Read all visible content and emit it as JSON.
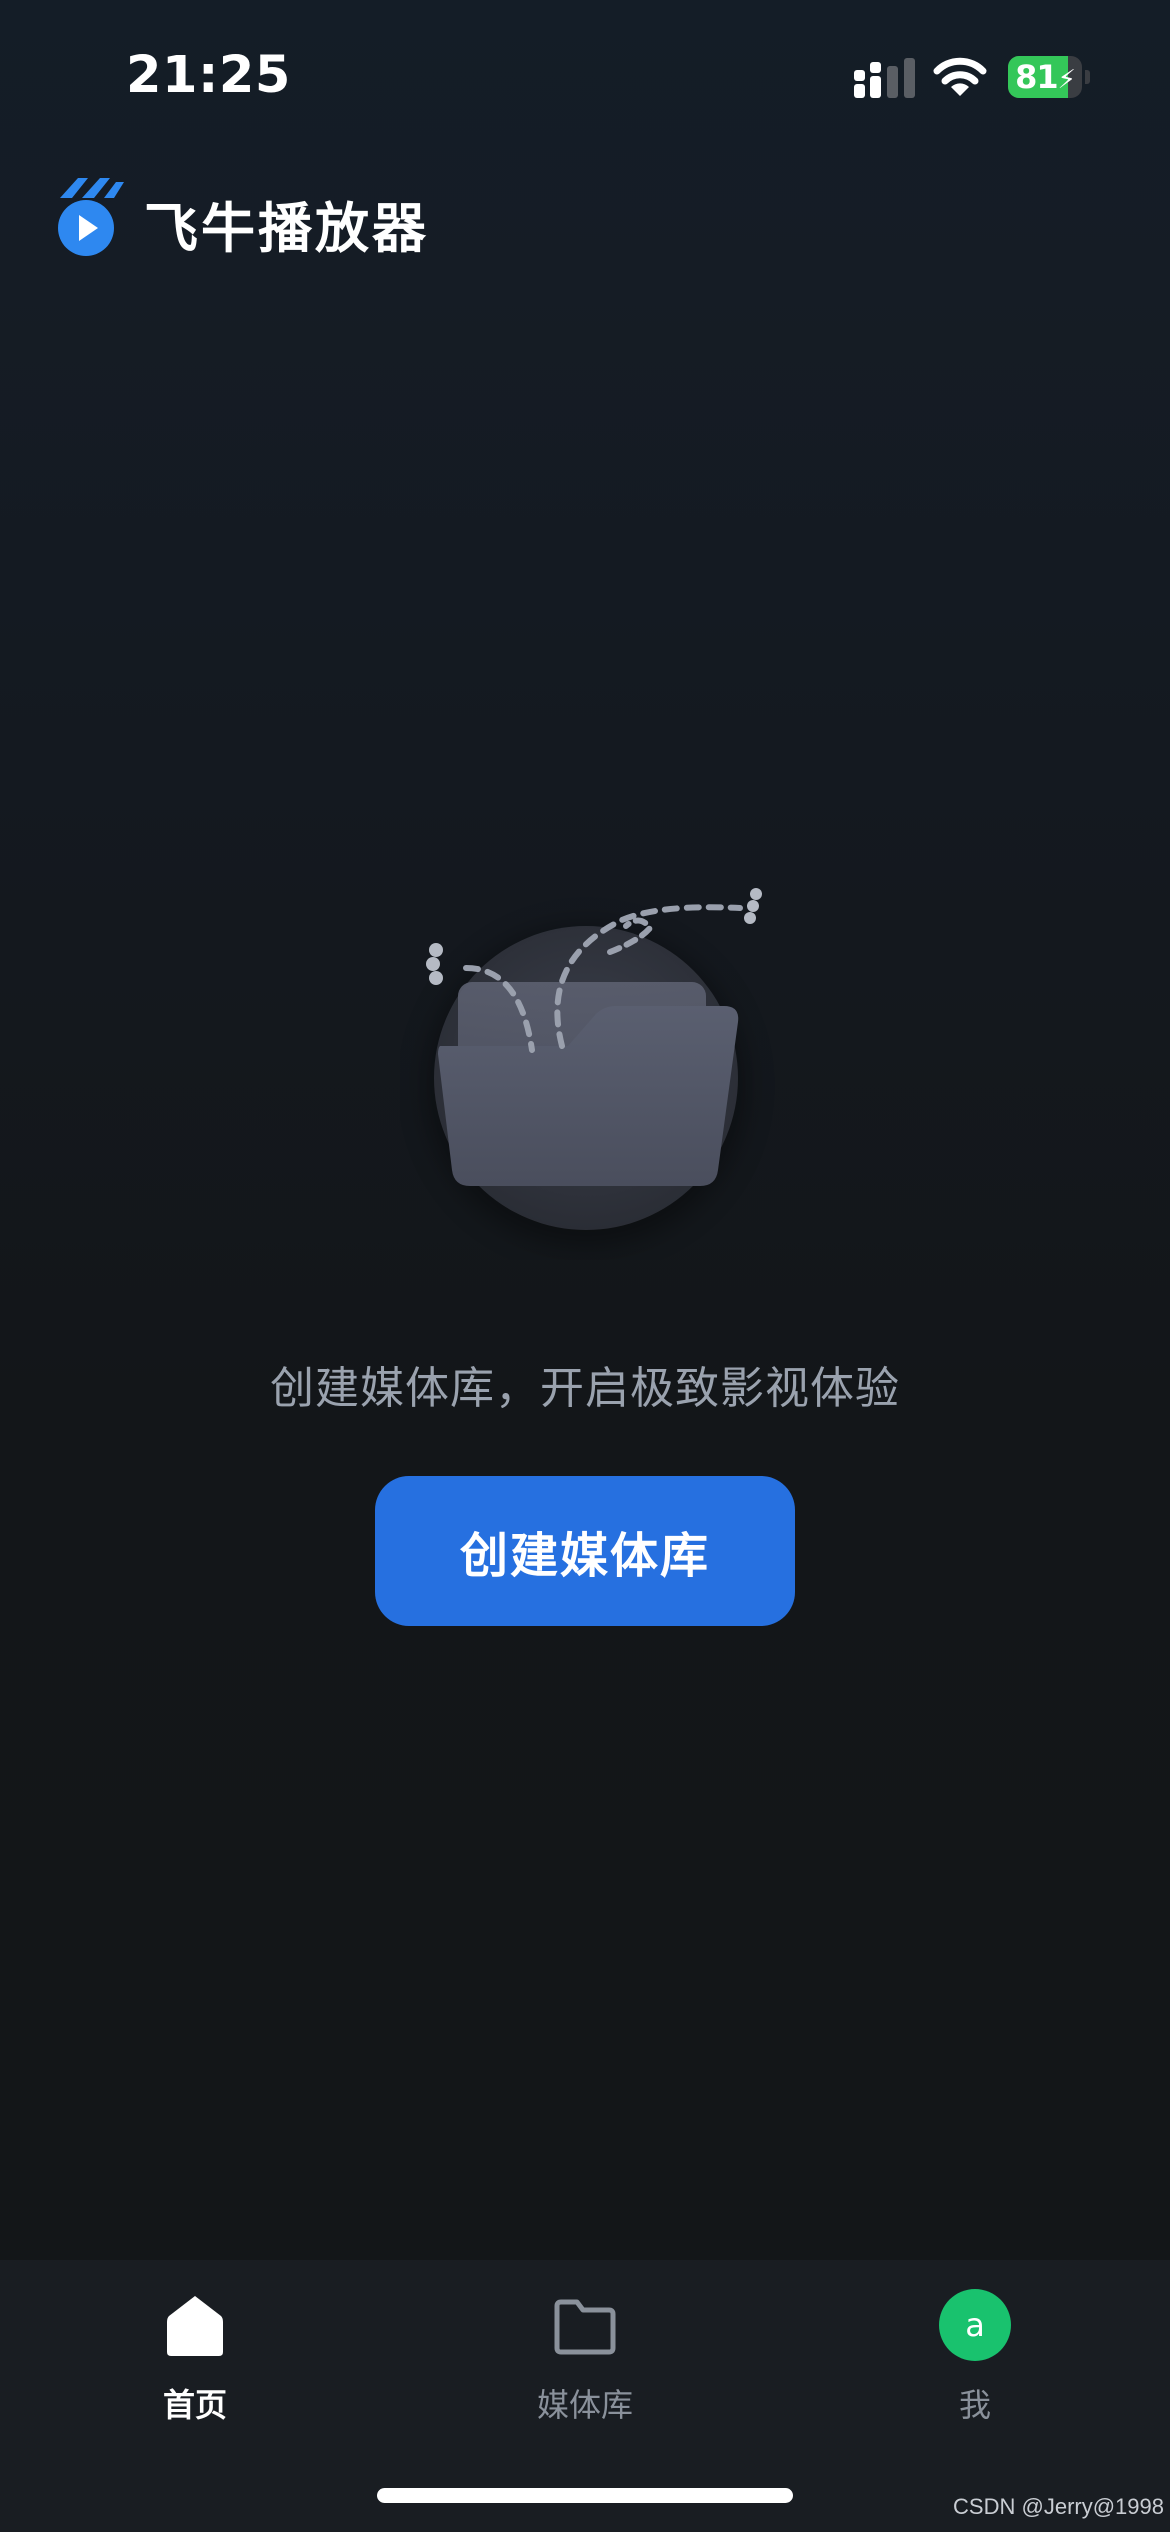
{
  "status_bar": {
    "time": "21:25",
    "battery_percent": "81",
    "battery_level": 0.81,
    "charging": true,
    "signal_icon": "cellular-signal-icon",
    "wifi_icon": "wifi-icon"
  },
  "header": {
    "app_name": "飞牛播放器",
    "logo_icon": "fn-player-logo-icon"
  },
  "empty_state": {
    "illustration_icon": "empty-folder-icon",
    "message": "创建媒体库，开启极致影视体验",
    "create_button_label": "创建媒体库"
  },
  "tab_bar": {
    "tabs": [
      {
        "label": "首页",
        "icon": "home-icon",
        "active": true
      },
      {
        "label": "媒体库",
        "icon": "folder-icon",
        "active": false
      },
      {
        "label": "我",
        "icon": "avatar",
        "active": false
      }
    ],
    "avatar_letter": "a"
  },
  "watermark": "CSDN @Jerry@1998",
  "colors": {
    "accent": "#2670e0",
    "avatar": "#19c26e",
    "battery": "#34c759",
    "background": "#131619",
    "tab_bar": "#191d22",
    "muted_text": "#9aa2ae"
  }
}
